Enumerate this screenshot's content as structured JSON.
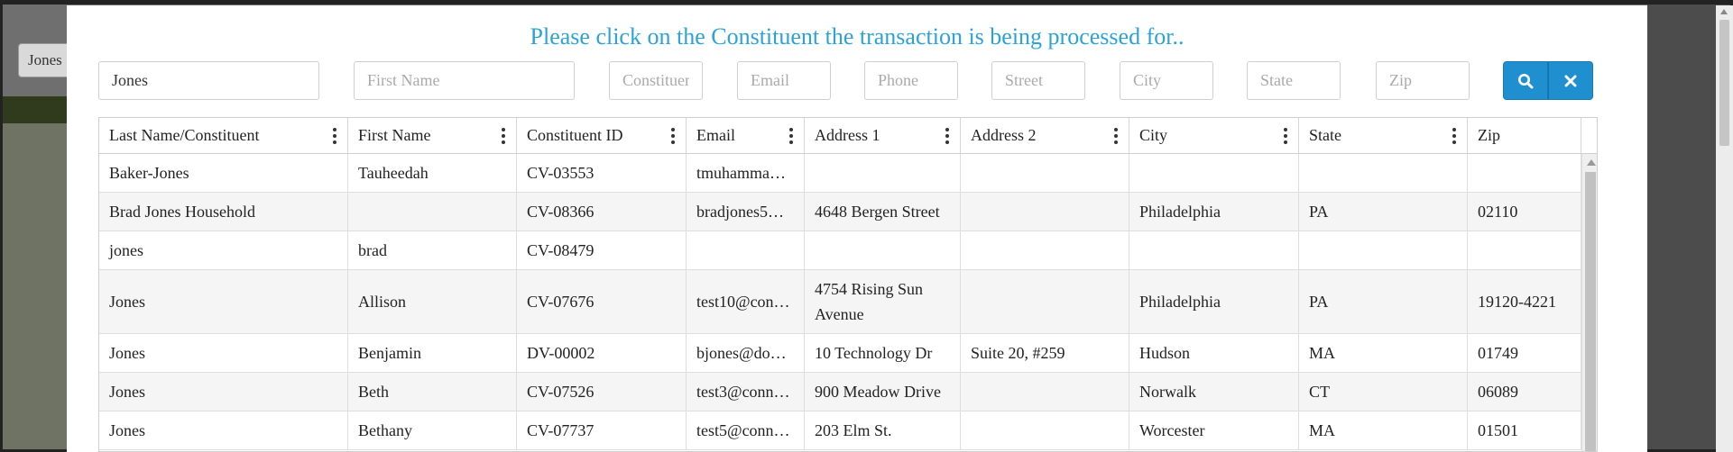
{
  "background": {
    "search_value": "Jones"
  },
  "modal": {
    "title": "Please click on the Constituent the transaction is being processed for..",
    "filters": {
      "last_name": {
        "value": "Jones",
        "placeholder": ""
      },
      "first_name": {
        "value": "",
        "placeholder": "First Name"
      },
      "constituent_id": {
        "value": "",
        "placeholder": "Constituent ID"
      },
      "email": {
        "value": "",
        "placeholder": "Email"
      },
      "phone": {
        "value": "",
        "placeholder": "Phone"
      },
      "street": {
        "value": "",
        "placeholder": "Street"
      },
      "city": {
        "value": "",
        "placeholder": "City"
      },
      "state": {
        "value": "",
        "placeholder": "State"
      },
      "zip": {
        "value": "",
        "placeholder": "Zip"
      }
    },
    "buttons": {
      "search_icon": "search-icon",
      "clear_icon": "close-icon"
    },
    "columns": [
      "Last Name/Constituent",
      "First Name",
      "Constituent ID",
      "Email",
      "Address 1",
      "Address 2",
      "City",
      "State",
      "Zip"
    ],
    "rows": [
      [
        "Baker-Jones",
        "Tauheedah",
        "CV-03553",
        "tmuhamma…",
        "",
        "",
        "",
        "",
        ""
      ],
      [
        "Brad Jones Household",
        "",
        "CV-08366",
        "bradjones5…",
        "4648 Bergen Street",
        "",
        "Philadelphia",
        "PA",
        "02110"
      ],
      [
        "jones",
        "brad",
        "CV-08479",
        "",
        "",
        "",
        "",
        "",
        ""
      ],
      [
        "Jones",
        "Allison",
        "CV-07676",
        "test10@con…",
        "4754 Rising Sun Avenue",
        "",
        "Philadelphia",
        "PA",
        "19120-4221"
      ],
      [
        "Jones",
        "Benjamin",
        "DV-00002",
        "bjones@do…",
        "10 Technology Dr",
        "Suite 20, #259",
        "Hudson",
        "MA",
        "01749"
      ],
      [
        "Jones",
        "Beth",
        "CV-07526",
        "test3@conn…",
        "900 Meadow Drive",
        "",
        "Norwalk",
        "CT",
        "06089"
      ],
      [
        "Jones",
        "Bethany",
        "CV-07737",
        "test5@conn…",
        "203 Elm St.",
        "",
        "Worcester",
        "MA",
        "01501"
      ]
    ],
    "accent_color": "#2aa3d8",
    "button_color": "#1f8fd0"
  }
}
